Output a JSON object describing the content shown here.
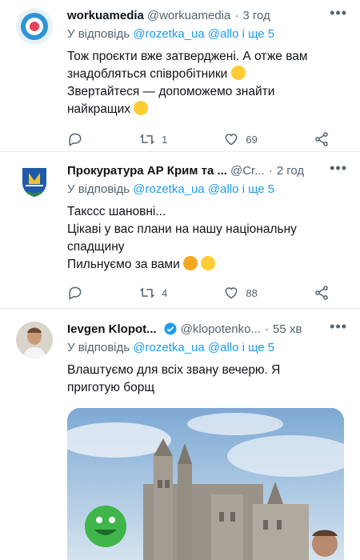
{
  "tweets": [
    {
      "name": "workuamedia",
      "handle": "@workuamedia",
      "sep": "·",
      "time": "3 год",
      "reply_prefix": "У відповідь",
      "reply_links": "@rozetka_ua @allo",
      "reply_and": "і ще 5",
      "lines": [
        "Тож проєкти вже затверджені. А отже вам",
        "знадобляться співробітники",
        "Звертайтеся — допоможемо знайти",
        "найкращих"
      ],
      "retweets": "1",
      "likes": "69"
    },
    {
      "name": "Прокуратура АР Крим та ...",
      "handle": "@Cr...",
      "sep": "·",
      "time": "2 год",
      "reply_prefix": "У відповідь",
      "reply_links": "@rozetka_ua @allo",
      "reply_and": "і ще 5",
      "lines": [
        "Таксcс шановні...",
        "Цікаві у вас плани на нашу національну",
        "спадщину",
        "Пильнуємо за вами"
      ],
      "retweets": "4",
      "likes": "88"
    },
    {
      "name": "Ievgen Klopot...",
      "handle": "@klopotenko...",
      "sep": "·",
      "time": "55 хв",
      "reply_prefix": "У відповідь",
      "reply_links": "@rozetka_ua @allo",
      "reply_and": "і ще 5",
      "lines": [
        "Влаштуємо для всіх звану вечерю. Я",
        "приготую борщ"
      ]
    }
  ],
  "colors": {
    "accent": "#1d9bf0",
    "muted": "#536471",
    "divider": "#e6ecf0"
  },
  "icons": [
    "reply-icon",
    "retweet-icon",
    "like-icon",
    "share-icon",
    "more-icon",
    "verified-icon"
  ]
}
